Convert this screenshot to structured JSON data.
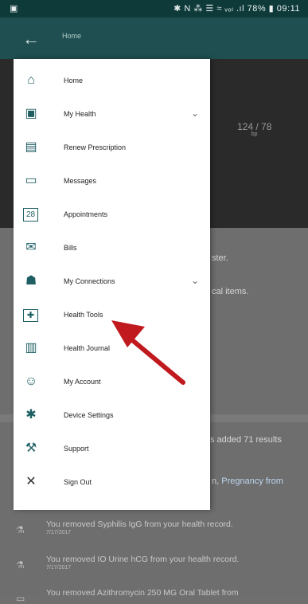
{
  "status_bar": {
    "left_icon": "photo-icon",
    "indicators": "✱ N ⁂ ☰ ≈ ᵥₒₗ .ıl 78% ▮ 09:11"
  },
  "app_bar": {
    "back_icon": "arrow-left-icon",
    "title": "Home"
  },
  "background": {
    "blood_pressure": "124 / 78",
    "blood_pressure_unit": "bp",
    "text_1": "ster.",
    "text_2": "cal items.",
    "feed_prefix": "s added 71 results",
    "feed_line_2_a": "n, ",
    "feed_line_2_b": "Pregnancy from",
    "activity": [
      {
        "text": "You removed Syphilis IgG from your health record.",
        "date": "7/17/2017"
      },
      {
        "text": "You removed IO Urine hCG from your health record.",
        "date": "7/17/2017"
      },
      {
        "text": "You removed Azithromycin 250 MG Oral Tablet from",
        "date": ""
      }
    ]
  },
  "drawer": {
    "items": [
      {
        "label": "Home",
        "icon": "home-icon",
        "glyph": "⌂",
        "has_chevron": false
      },
      {
        "label": "My Health",
        "icon": "clipboard-icon",
        "glyph": "▣",
        "has_chevron": true
      },
      {
        "label": "Renew Prescription",
        "icon": "pill-bottle-icon",
        "glyph": "▤",
        "has_chevron": false
      },
      {
        "label": "Messages",
        "icon": "message-icon",
        "glyph": "▭",
        "has_chevron": false
      },
      {
        "label": "Appointments",
        "icon": "calendar-icon",
        "glyph": "28",
        "has_chevron": false
      },
      {
        "label": "Bills",
        "icon": "bill-icon",
        "glyph": "✉",
        "has_chevron": false
      },
      {
        "label": "My Connections",
        "icon": "people-icon",
        "glyph": "☗",
        "has_chevron": true
      },
      {
        "label": "Health Tools",
        "icon": "medical-kit-icon",
        "glyph": "✚",
        "has_chevron": false
      },
      {
        "label": "Health Journal",
        "icon": "journal-icon",
        "glyph": "▥",
        "has_chevron": false
      },
      {
        "label": "My Account",
        "icon": "account-icon",
        "glyph": "☺",
        "has_chevron": false
      },
      {
        "label": "Device Settings",
        "icon": "gear-icon",
        "glyph": "✱",
        "has_chevron": false
      },
      {
        "label": "Support",
        "icon": "wrench-icon",
        "glyph": "⚒",
        "has_chevron": false
      },
      {
        "label": "Sign Out",
        "icon": "close-icon",
        "glyph": "✕",
        "has_chevron": false
      }
    ]
  },
  "chevron_glyph": "⌄",
  "annotation_color": "#c0191e"
}
